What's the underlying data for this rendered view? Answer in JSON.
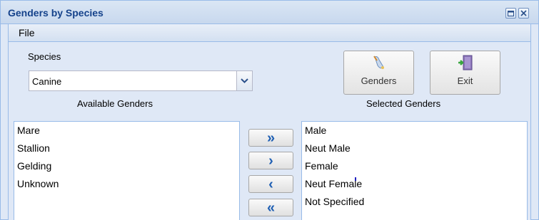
{
  "window": {
    "title": "Genders by Species"
  },
  "menu": {
    "file_label": "File"
  },
  "species": {
    "label": "Species",
    "value": "Canine"
  },
  "labels": {
    "available": "Available Genders",
    "selected": "Selected Genders"
  },
  "toolbar": {
    "genders_label": "Genders",
    "exit_label": "Exit"
  },
  "available_genders": [
    "Mare",
    "Stallion",
    "Gelding",
    "Unknown"
  ],
  "selected_genders": [
    "Male",
    "Neut Male",
    "Female",
    "Neut Female",
    "Not Specified"
  ],
  "move_buttons": {
    "add_all": "»",
    "add": "›",
    "remove": "‹",
    "remove_all": "«"
  },
  "colors": {
    "title_text": "#15428b",
    "arrow": "#1f5fb3",
    "panel_bg": "#dfe8f6",
    "border": "#99bbe8"
  }
}
